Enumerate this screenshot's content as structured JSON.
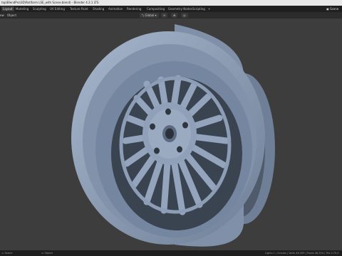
{
  "window": {
    "title": "top\\BlendPro\\3D\\Rotiform LSE_with Scene.blend) - Blender 4.2.1 LTS"
  },
  "topbar": {
    "tabs": [
      {
        "label": "Layout",
        "active": true
      },
      {
        "label": "Modeling"
      },
      {
        "label": "Sculpting"
      },
      {
        "label": "UV Editing"
      },
      {
        "label": "Texture Paint"
      },
      {
        "label": "Shading"
      },
      {
        "label": "Animation"
      },
      {
        "label": "Rendering"
      },
      {
        "label": "Compositing"
      },
      {
        "label": "Geometry Nodes"
      },
      {
        "label": "Scripting"
      },
      {
        "label": "+"
      }
    ],
    "scene_label": "Scene"
  },
  "toolbar": {
    "view_menu": "ew",
    "object_menu": "Object",
    "orientation": "Global"
  },
  "statusbar": {
    "left_text": "Select",
    "middle_text": "Object",
    "right_text": "Lights 1 | Scenes | Verts 46,359 | Faces 46,354 | Tris 0.75.0"
  },
  "colors": {
    "wheel_fill": "#8fa0b8",
    "wheel_dark": "#6f7f97",
    "viewport_bg": "#3d3d3d"
  }
}
